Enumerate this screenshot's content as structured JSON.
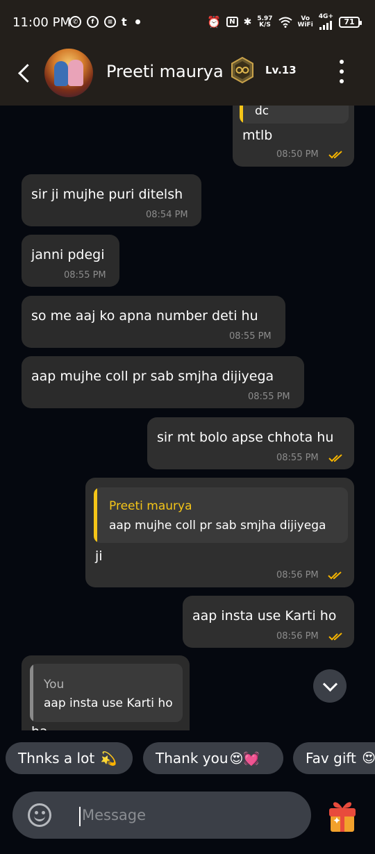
{
  "status_bar": {
    "time": "11:00 PM",
    "net_speed_value": "5.97",
    "net_speed_unit": "K/S",
    "vowifi_top": "Vo",
    "vowifi_bottom": "WiFi",
    "network": "4G+",
    "battery": "71",
    "icons": [
      "whatsapp-icon",
      "facebook-icon",
      "messenger-icon",
      "tumblr-icon",
      "alarm-icon",
      "nfc-icon",
      "bluetooth-icon",
      "wifi-icon",
      "signal-icon"
    ]
  },
  "header": {
    "contact_name": "Preeti maurya",
    "level": "Lv.13",
    "back_icon": "back-arrow-icon",
    "menu_icon": "more-vert-icon"
  },
  "colors": {
    "quote_bar_self": "#f5c518",
    "quote_bar_other": "#8a8a8a",
    "tick_color": "#f5b400",
    "quote_name_color": "#f5c518"
  },
  "messages": [
    {
      "id": "m0",
      "direction": "out",
      "partial_quote_text": "dc",
      "text": "mtlb",
      "time": "08:50 PM",
      "status": "read"
    },
    {
      "id": "m1",
      "direction": "in",
      "text": "sir ji mujhe puri ditelsh",
      "time": "08:54 PM"
    },
    {
      "id": "m2",
      "direction": "in",
      "text": "janni pdegi",
      "time": "08:55 PM"
    },
    {
      "id": "m3",
      "direction": "in",
      "text": "so me aaj ko apna number deti hu",
      "time": "08:55 PM"
    },
    {
      "id": "m4",
      "direction": "in",
      "text": "aap mujhe coll pr sab smjha dijiyega",
      "time": "08:55 PM"
    },
    {
      "id": "m5",
      "direction": "out",
      "text": "sir mt bolo apse chhota hu",
      "time": "08:55 PM",
      "status": "read"
    },
    {
      "id": "m6",
      "direction": "out",
      "quote": {
        "name": "Preeti maurya",
        "text": "aap mujhe coll pr sab smjha dijiyega"
      },
      "text": "ji",
      "time": "08:56 PM",
      "status": "read"
    },
    {
      "id": "m7",
      "direction": "out",
      "text": "aap insta use Karti ho",
      "time": "08:56 PM",
      "status": "read"
    },
    {
      "id": "m8",
      "direction": "in",
      "quote": {
        "name": "You",
        "text": "aap insta use Karti ho"
      },
      "text": "ha"
    }
  ],
  "quick_replies": [
    {
      "label": "Thnks a lot",
      "emoji": "💫"
    },
    {
      "label": "Thank you",
      "emoji": "😍💓"
    },
    {
      "label": "Fav gift",
      "emoji": "😍"
    }
  ],
  "composer": {
    "placeholder": "Message",
    "emoji_icon": "emoji-smiley-icon",
    "gift_icon": "gift-icon"
  }
}
